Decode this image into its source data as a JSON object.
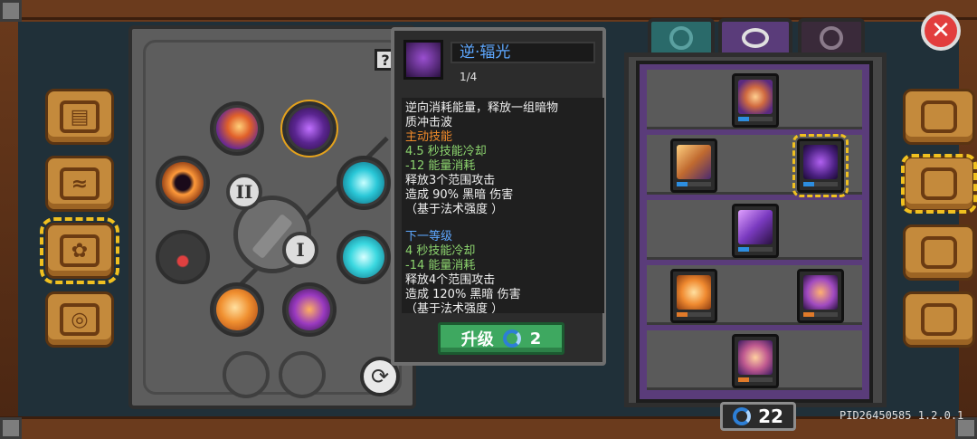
{
  "skill_tooltip": {
    "name": "逆·辐光",
    "level": "1/4",
    "lines": [
      {
        "text": "逆向消耗能量，释放一组暗物",
        "color": "white"
      },
      {
        "text": "质冲击波",
        "color": "white"
      },
      {
        "text": "主动技能",
        "color": "orange"
      },
      {
        "text": "4.5 秒技能冷却",
        "color": "green"
      },
      {
        "text": "-12 能量消耗",
        "color": "green"
      },
      {
        "text": "释放3个范围攻击",
        "color": "white"
      },
      {
        "text": "造成 90% 黑暗 伤害",
        "color": "white"
      },
      {
        "text": "（基于法术强度 ）",
        "color": "white"
      }
    ],
    "next_header": "下一等级",
    "next_lines": [
      {
        "text": "4 秒技能冷却",
        "color": "green"
      },
      {
        "text": "-14 能量消耗",
        "color": "green"
      },
      {
        "text": "释放4个范围攻击",
        "color": "white"
      },
      {
        "text": "造成 120% 黑暗 伤害",
        "color": "white"
      },
      {
        "text": "（基于法术强度 ）",
        "color": "white"
      }
    ],
    "upgrade_label": "升级",
    "upgrade_cost": "2"
  },
  "tree": {
    "roman_two": "II",
    "roman_one": "I",
    "help": "?",
    "refresh_glyph": "⟳"
  },
  "currency": {
    "gems": "22"
  },
  "build": "PID26450585 1.2.0.1",
  "close_glyph": "✕",
  "colors": {
    "accent": "#f0c020",
    "upgrade": "#3ea860",
    "name": "#5ea8ff"
  }
}
